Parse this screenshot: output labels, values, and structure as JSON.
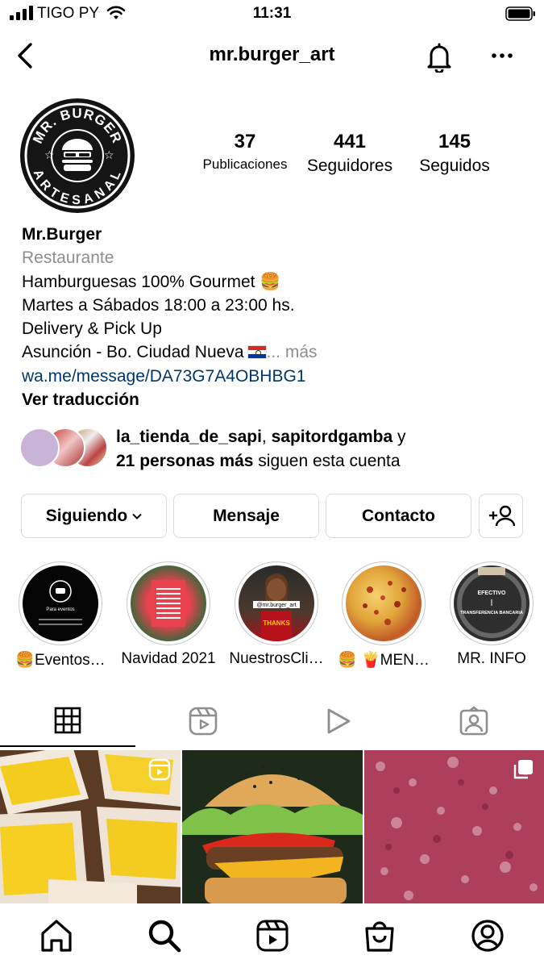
{
  "status_bar": {
    "carrier": "TIGO PY",
    "time": "11:31"
  },
  "header": {
    "username": "mr.burger_art"
  },
  "profile": {
    "avatar_text_top": "MR. BURGER",
    "avatar_text_bottom": "ARTESANAL",
    "stats": {
      "posts_count": "37",
      "posts_label": "Publicaciones",
      "followers_count": "441",
      "followers_label": "Seguidores",
      "following_count": "145",
      "following_label": "Seguidos"
    },
    "name": "Mr.Burger",
    "category": "Restaurante",
    "bio_lines": [
      "Hamburguesas 100% Gourmet 🍔",
      "Martes a Sábados 18:00 a 23:00 hs.",
      "Delivery & Pick Up",
      "Asunción - Bo. Ciudad Nueva"
    ],
    "bio_more": "... más",
    "link": "wa.me/message/DA73G7A4OBHBG1",
    "translate": "Ver traducción"
  },
  "mutual": {
    "user1": "la_tienda_de_sapi",
    "sep": ",",
    "user2": "sapitordgamba",
    "and": " y",
    "count": "21 personas más",
    "suffix": " siguen esta cuenta"
  },
  "buttons": {
    "following": "Siguiendo",
    "message": "Mensaje",
    "contact": "Contacto"
  },
  "highlights": [
    {
      "label": "🍔Eventos…",
      "image_text": "Para eventos"
    },
    {
      "label": "Navidad 2021",
      "image_text": ""
    },
    {
      "label": "NuestrosCli…",
      "image_text": "@mr.burger_art",
      "image_text2": "THANKS"
    },
    {
      "label": "🍔 🍟MEN…",
      "image_text": ""
    },
    {
      "label": "MR. INFO",
      "image_text": "EFECTIVO",
      "image_text2": "TRANSFERENCIA BANCARIA"
    }
  ],
  "tabs": [
    "grid-icon",
    "reels-icon",
    "videos-icon",
    "tagged-icon"
  ],
  "colors": {
    "link": "#00376b",
    "secondary": "#8e8e8e",
    "border": "#dbdbdb"
  }
}
